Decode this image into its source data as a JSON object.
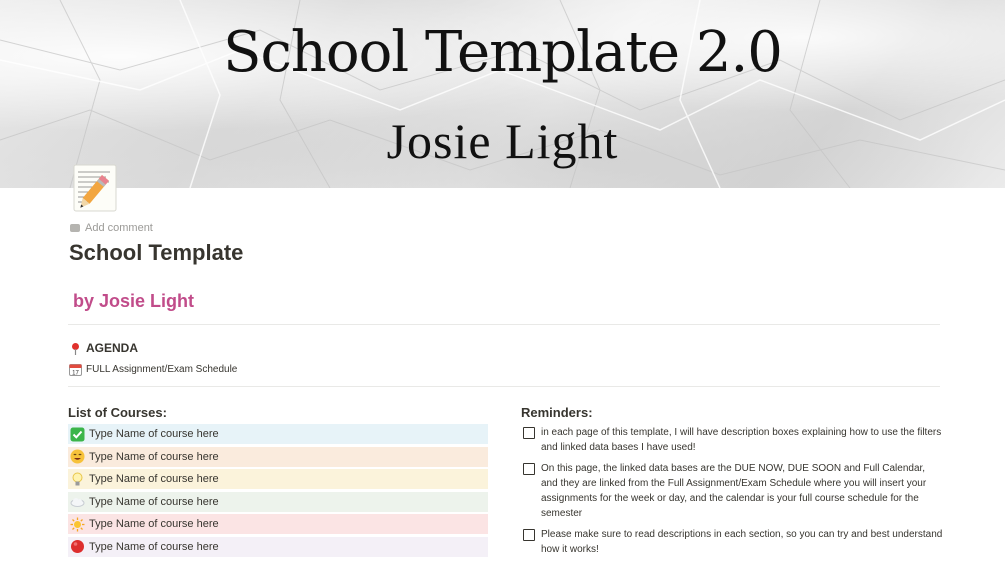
{
  "cover": {
    "title": "School Template 2.0",
    "subtitle": "Josie Light"
  },
  "page": {
    "icon": "memo-pencil-icon",
    "add_comment": "Add comment",
    "title": "School Template",
    "byline": "by Josie Light",
    "byline_color": "#c14c8a"
  },
  "links": [
    {
      "icon": "pin-icon",
      "label": "AGENDA"
    },
    {
      "icon": "calendar-icon",
      "label": "FULL Assignment/Exam Schedule"
    }
  ],
  "courses": {
    "heading": "List of Courses:",
    "items": [
      {
        "icon": "check-box-icon",
        "label": "Type Name of course here",
        "bg": "#e7f3f8"
      },
      {
        "icon": "smiley-icon",
        "label": "Type Name of course here",
        "bg": "#faebdd"
      },
      {
        "icon": "lightbulb-icon",
        "label": "Type Name of course here",
        "bg": "#fbf3db"
      },
      {
        "icon": "cloud-icon",
        "label": "Type Name of course here",
        "bg": "#edf3ec"
      },
      {
        "icon": "sun-icon",
        "label": "Type Name of course here",
        "bg": "#fbe4e4"
      },
      {
        "icon": "red-circle-icon",
        "label": "Type Name of course here",
        "bg": "#f4f0f7"
      }
    ]
  },
  "reminders": {
    "heading": "Reminders:",
    "items": [
      {
        "checked": false,
        "text": "in each page of this template,  I will have description boxes explaining how to use the filters and linked data bases I have used!"
      },
      {
        "checked": false,
        "text": "On this page, the linked data bases are the DUE NOW, DUE SOON and Full Calendar, and they are linked from the Full Assignment/Exam Schedule where you will insert your assignments for the week or day, and the calendar is your full course schedule for the semester"
      },
      {
        "checked": false,
        "text": "Please make sure to read descriptions in each section, so you can try and best understand how it works!"
      }
    ]
  }
}
